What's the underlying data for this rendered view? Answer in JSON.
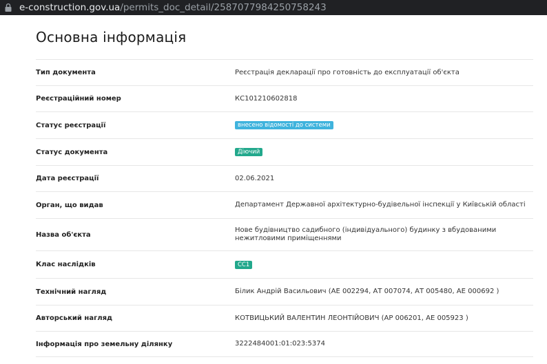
{
  "browser": {
    "url_host": "e-construction.gov.ua",
    "url_path": "/permits_doc_detail/2587077984250758243"
  },
  "page": {
    "title": "Основна інформація"
  },
  "colors": {
    "badge_blue": "#3fb3dd",
    "badge_green": "#22a88c"
  },
  "rows": [
    {
      "label": "Тип документа",
      "value": "Реєстрація декларації про готовність до експлуатації об'єкта"
    },
    {
      "label": "Реєстраційний номер",
      "value": "КС101210602818"
    },
    {
      "label": "Статус реєстрації",
      "badge": "внесено відомості до системи"
    },
    {
      "label": "Статус документа",
      "badge": "Діючий"
    },
    {
      "label": "Дата реєстрації",
      "value": "02.06.2021"
    },
    {
      "label": "Орган, що видав",
      "value": "Департамент Державної архітектурно-будівельної інспекції у Київській області"
    },
    {
      "label": "Назва об'єкта",
      "value": "Нове будівництво садибного (індивідуального) будинку з вбудованими нежитловими приміщеннями"
    },
    {
      "label": "Клас наслідків",
      "badge": "СС1"
    },
    {
      "label": "Технічний нагляд",
      "value": "Білик Андрій Васильович (АЕ 002294, АТ 007074, АТ 005480, АЕ 000692 )"
    },
    {
      "label": "Авторський нагляд",
      "value": "КОТВИЦЬКИЙ ВАЛЕНТИН ЛЕОНТІЙОВИЧ (АР 006201, АЕ 005923 )"
    },
    {
      "label": "Інформація про земельну ділянку",
      "value": "3222484001:01:023:5374"
    }
  ]
}
